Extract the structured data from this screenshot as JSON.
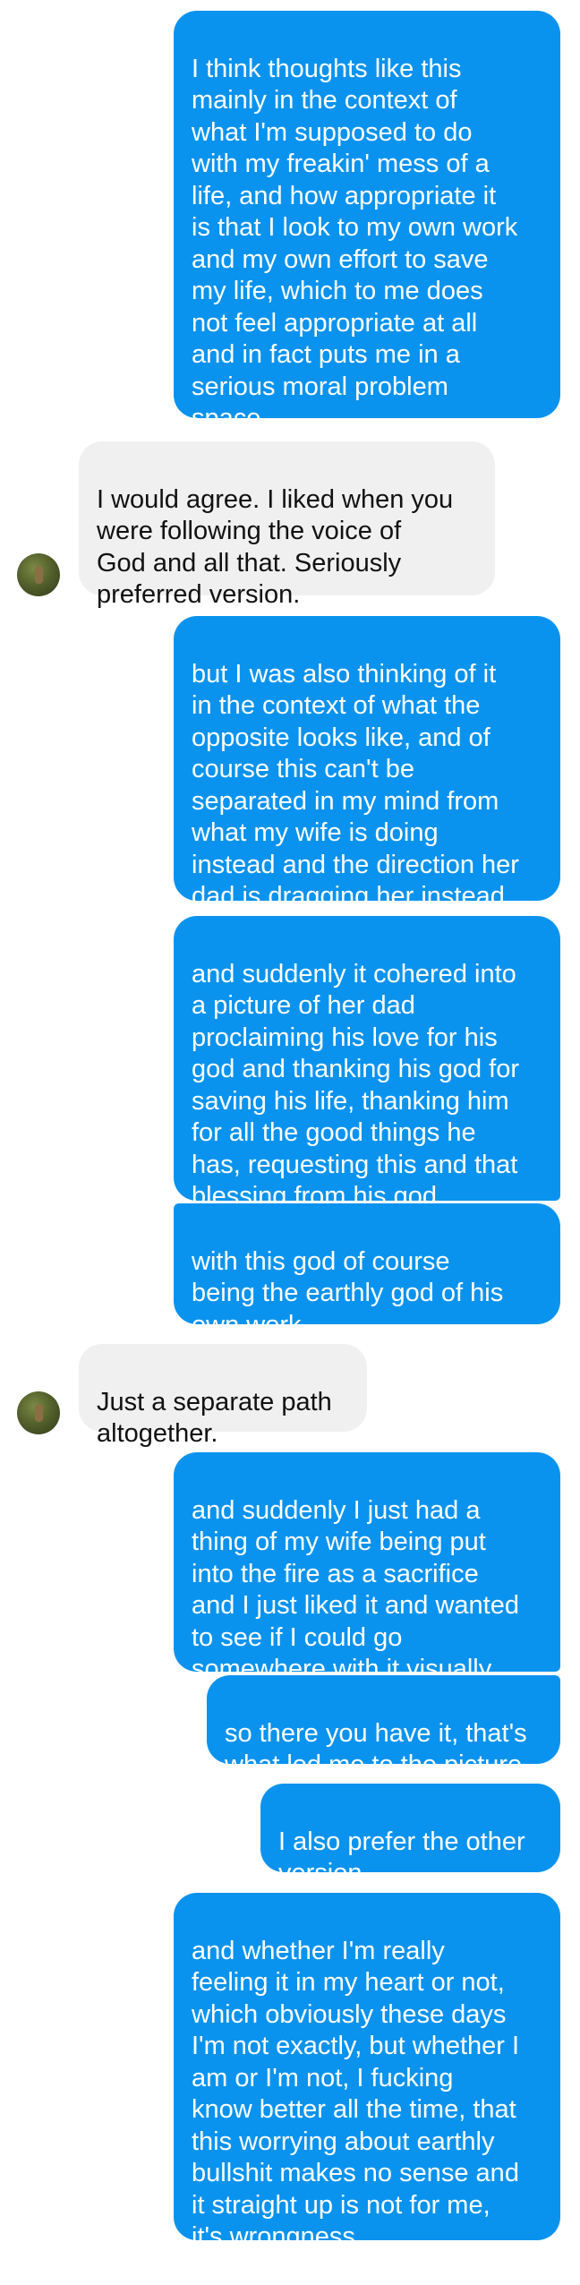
{
  "messages": [
    {
      "id": 1,
      "side": "sent",
      "text": "I think thoughts like this\nmainly in the context of\nwhat I'm supposed to do\nwith my freakin' mess of a\nlife, and how appropriate it\nis that I look to my own work\nand my own effort to save\nmy life, which to me does\nnot feel appropriate at all\nand in fact puts me in a\nserious moral problem\nspace"
    },
    {
      "id": 2,
      "side": "received",
      "text": "I would agree. I liked when you\nwere following the voice of\nGod and all that. Seriously\npreferred version."
    },
    {
      "id": 3,
      "side": "sent",
      "text": "but I was also thinking of it\nin the context of what the\nopposite looks like, and of\ncourse this can't be\nseparated in my mind from\nwhat my wife is doing\ninstead and the direction her\ndad is dragging her instead"
    },
    {
      "id": 4,
      "side": "sent",
      "text": "and suddenly it cohered into\na picture of her dad\nproclaiming his love for his\ngod and thanking his god for\nsaving his life, thanking him\nfor all the good things he\nhas, requesting this and that\nblessing from his god"
    },
    {
      "id": 5,
      "side": "sent",
      "text": "with this god of course\nbeing the earthly god of his\nown work"
    },
    {
      "id": 6,
      "side": "received",
      "text": "Just a separate path\naltogether."
    },
    {
      "id": 7,
      "side": "sent",
      "text": "and suddenly I just had a\nthing of my wife being put\ninto the fire as a sacrifice\nand I just liked it and wanted\nto see if I could go\nsomewhere with it visually"
    },
    {
      "id": 8,
      "side": "sent",
      "text": "so there you have it, that's\nwhat led me to the picture"
    },
    {
      "id": 9,
      "side": "sent",
      "text": "I also prefer the other\nversion"
    },
    {
      "id": 10,
      "side": "sent",
      "text": "and whether I'm really\nfeeling it in my heart or not,\nwhich obviously these days\nI'm not exactly, but whether I\nam or I'm not, I fucking\nknow better all the time, that\nthis worrying about earthly\nbullshit makes no sense and\nit straight up is not for me,\nit's wrongness"
    }
  ],
  "colors": {
    "sent_bubble": "#0a93ee",
    "sent_text": "#ffffff",
    "received_bubble": "#f0f0f0",
    "received_text": "#111111",
    "background": "#ffffff"
  },
  "icons": {
    "contact_avatar": "avatar"
  }
}
